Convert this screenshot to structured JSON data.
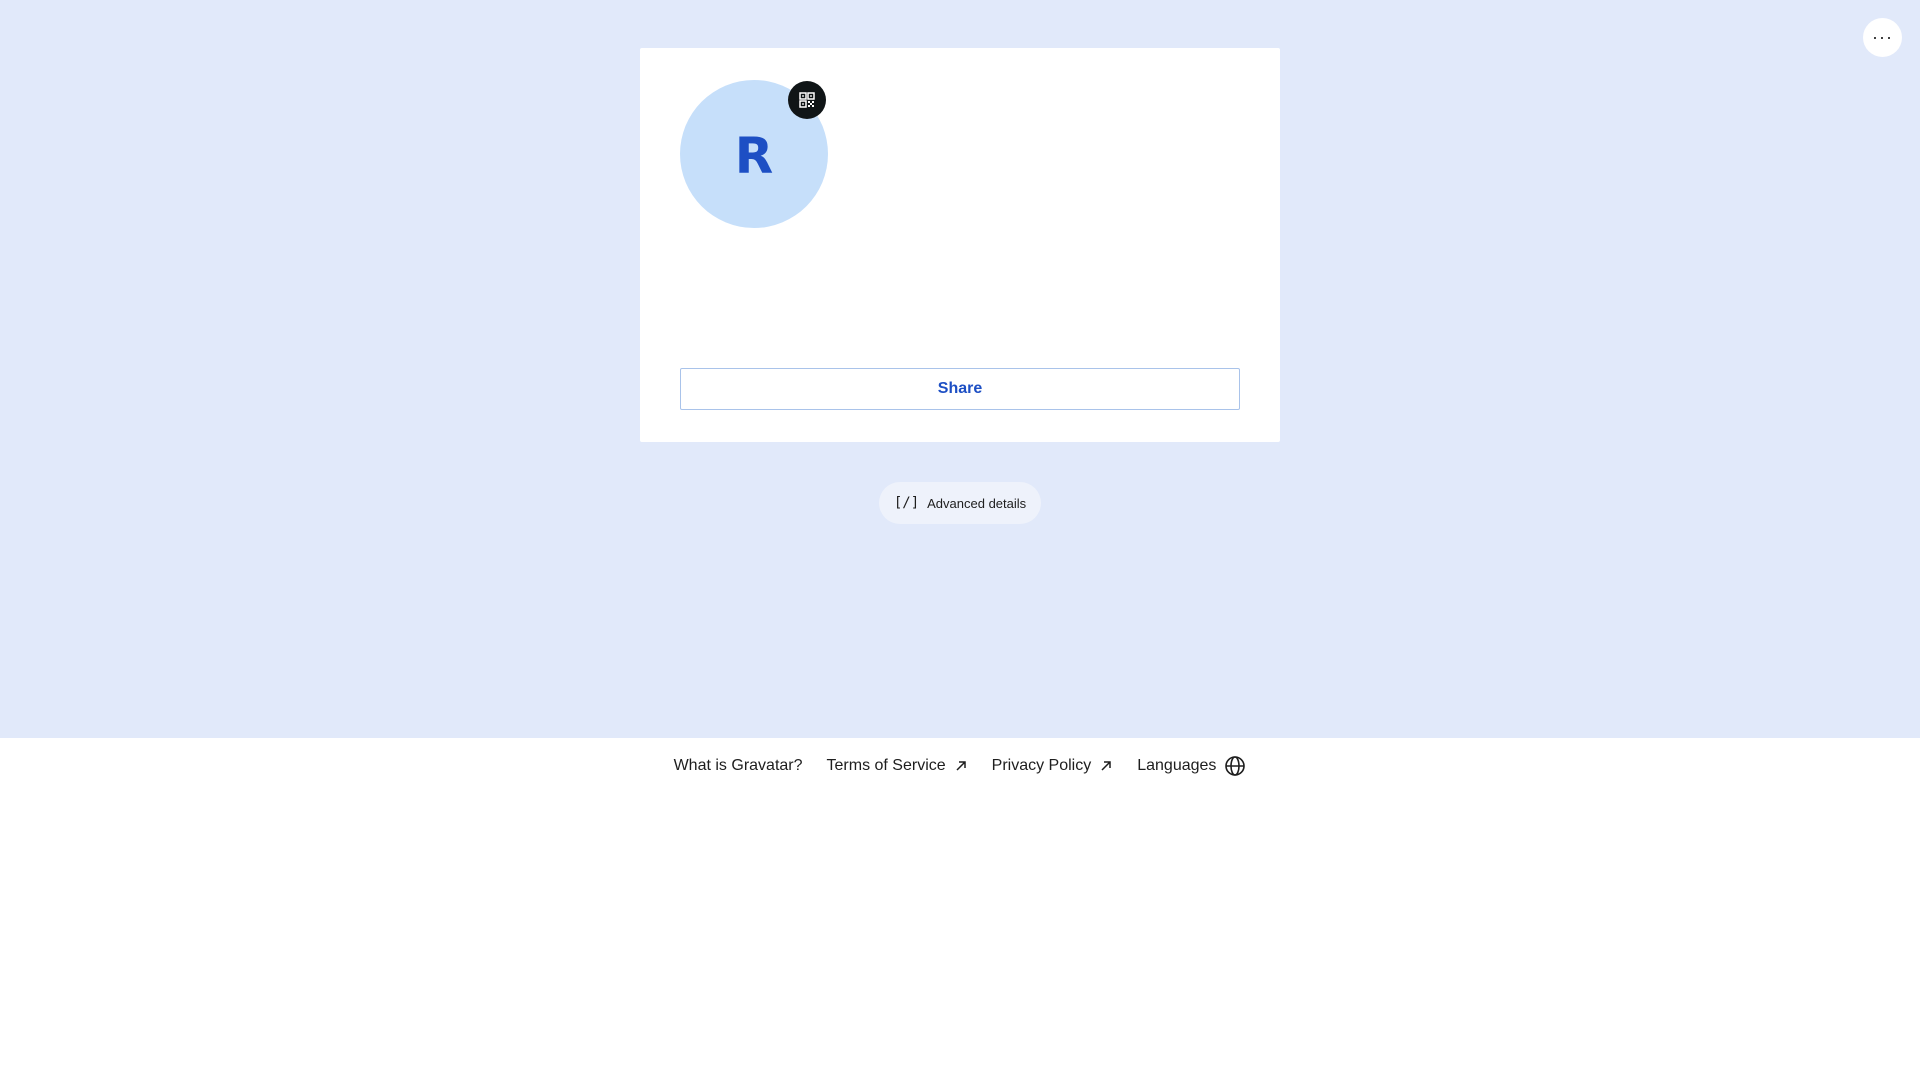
{
  "header": {
    "more_icon": "more-horizontal-icon",
    "more_label": "···"
  },
  "profile": {
    "avatar_initial": "R",
    "avatar_color": "#c6dffa",
    "initial_color": "#1d4fc4",
    "qr_icon": "qr-code-icon",
    "share_label": "Share"
  },
  "advanced": {
    "icon_text": "[/]",
    "label": "Advanced details"
  },
  "footer": {
    "links": [
      {
        "label": "What is Gravatar?",
        "icon": ""
      },
      {
        "label": "Terms of Service",
        "icon": "external-arrow-icon"
      },
      {
        "label": "Privacy Policy",
        "icon": "external-arrow-icon"
      },
      {
        "label": "Languages",
        "icon": "globe-icon"
      }
    ]
  },
  "colors": {
    "page_background": "#e1e9fa",
    "accent": "#1d4fc4"
  }
}
